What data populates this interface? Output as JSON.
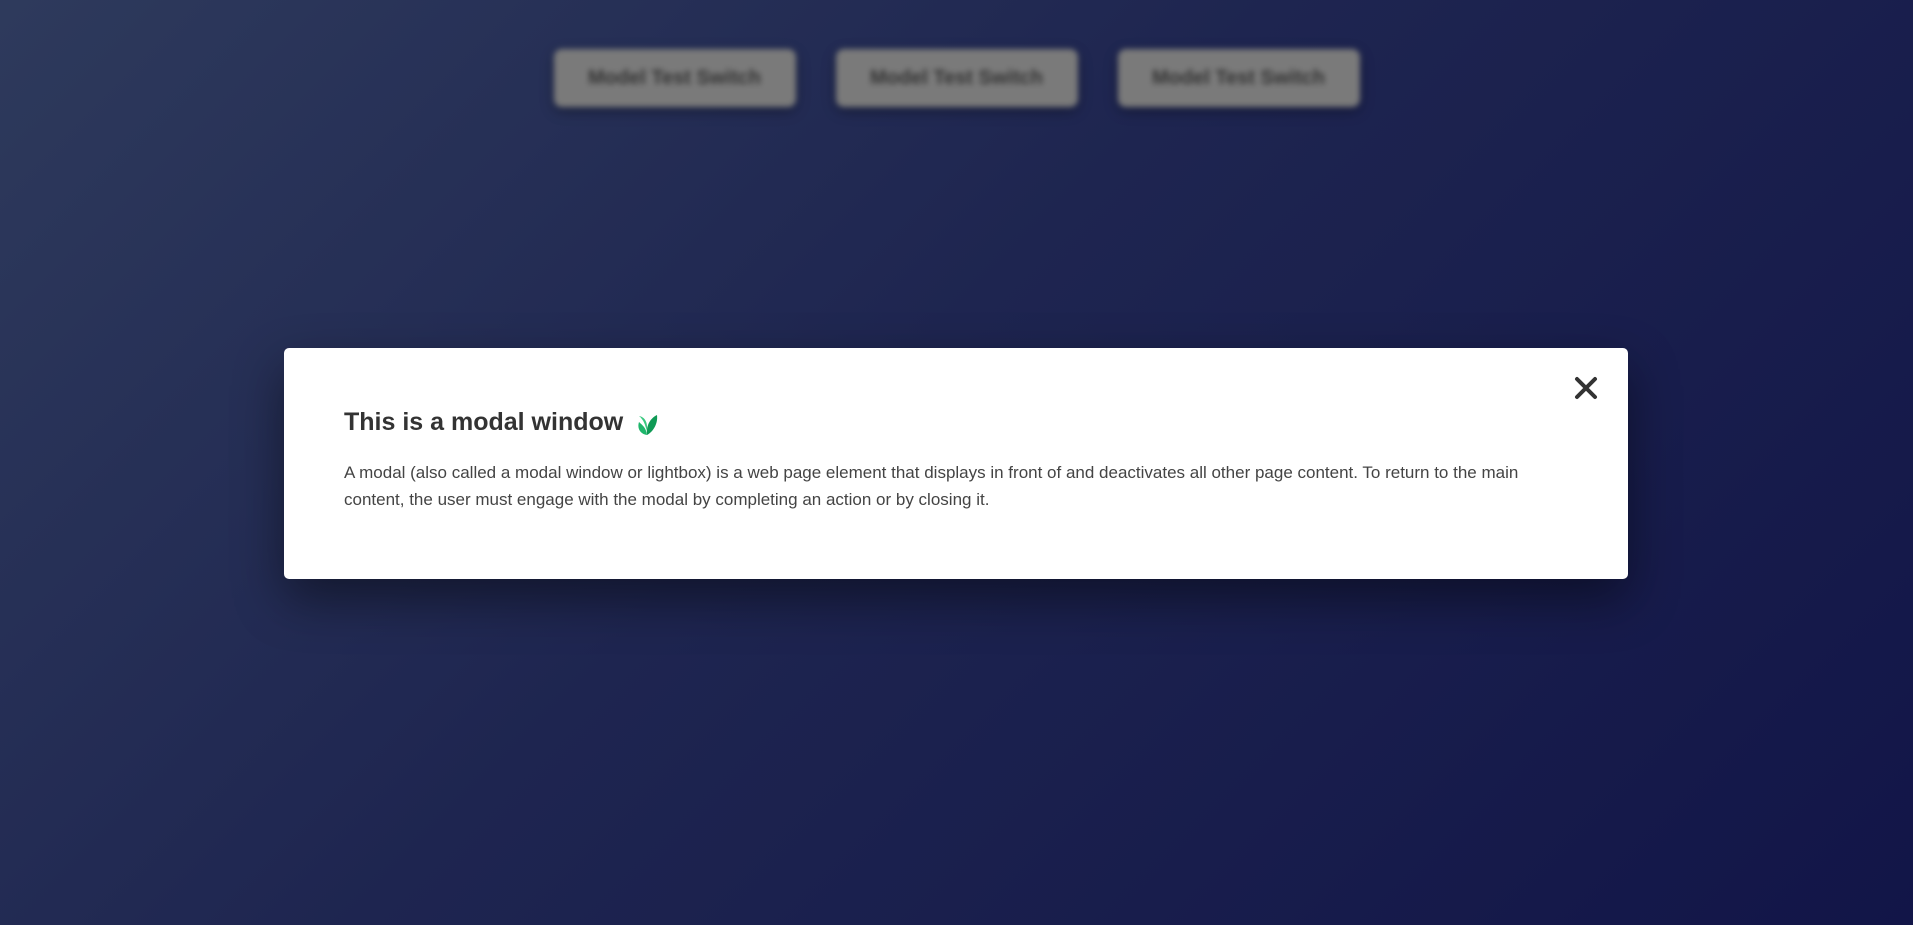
{
  "background": {
    "switch_buttons": [
      {
        "label": "Model Test Switch"
      },
      {
        "label": "Model Test Switch"
      },
      {
        "label": "Model Test Switch"
      }
    ]
  },
  "modal": {
    "title": "This is a modal window",
    "title_icon": "seedling-icon",
    "body": "A modal (also called a modal window or lightbox) is a web page element that displays in front of and deactivates all other page content. To return to the main content, the user must engage with the modal by completing an action or by closing it.",
    "close_icon": "close-icon"
  },
  "colors": {
    "background_start": "#2e3a5c",
    "background_end": "#121548",
    "switch_button": "#7a7a7a",
    "modal_background": "#ffffff",
    "title_text": "#333333",
    "leaf_green": "#1fb66b"
  }
}
